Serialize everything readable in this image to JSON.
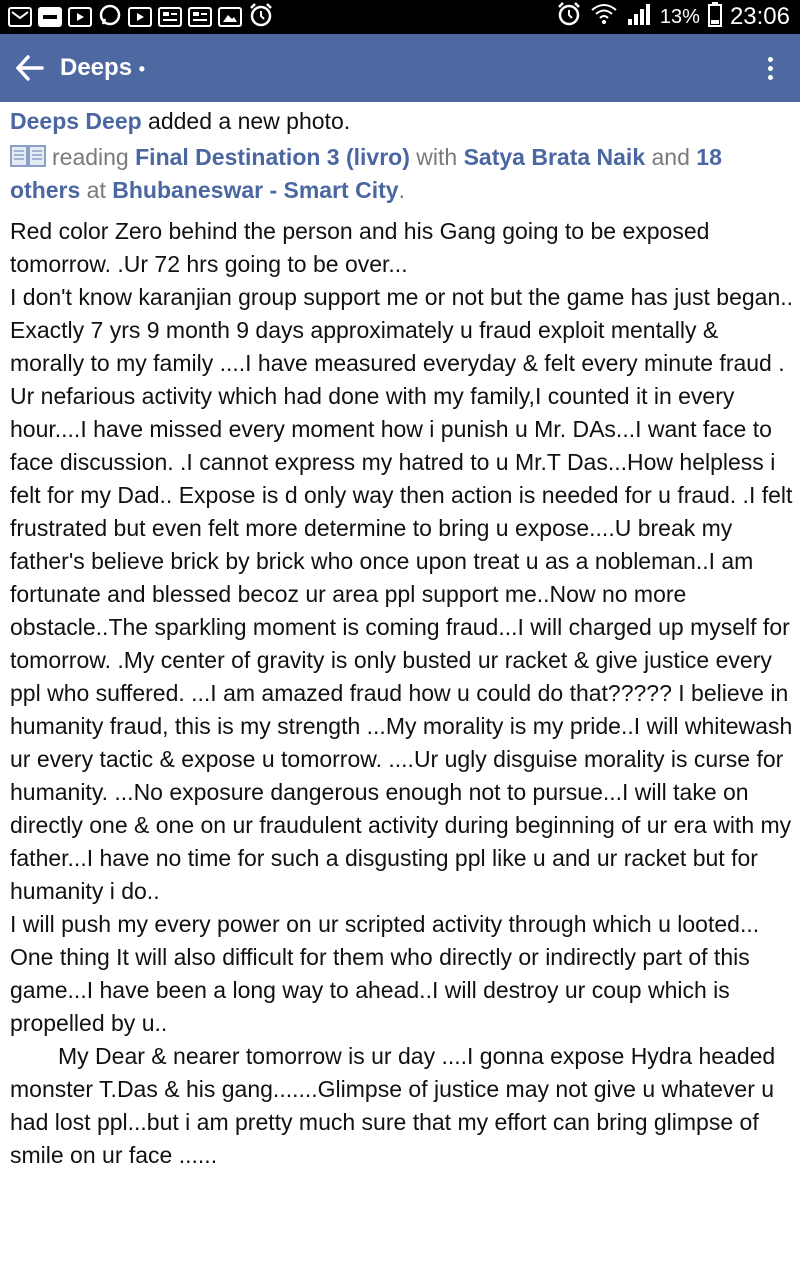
{
  "status_bar": {
    "battery_percent": "13%",
    "time": "23:06"
  },
  "app_bar": {
    "title": "Deeps",
    "title_dot": "•"
  },
  "post": {
    "author": "Deeps Deep",
    "action": " added a new photo.",
    "activity_verb": "reading ",
    "book": "Final Destination 3 (livro)",
    "with_word": " with ",
    "tagged_person": "Satya Brata Naik",
    "and_word": " and ",
    "others": "18 others",
    "at_word": " at ",
    "location": "Bhubaneswar - Smart City",
    "end_period": ".",
    "paragraphs": [
      "Red color Zero behind the person and his Gang going to be exposed tomorrow. .Ur 72 hrs going to be over...",
      "I don't know karanjian group  support me or not but the game has just began..",
      "Exactly 7 yrs 9 month 9 days approximately u fraud exploit mentally & morally to my family ....I have measured everyday & felt every minute fraud . Ur nefarious activity which had done with my family,I counted it in every hour....I have missed every moment how i punish u Mr. DAs...I want  face to face discussion. .I cannot express my hatred to u Mr.T Das...How helpless i felt for my Dad.. Expose is d only way then action is needed for u fraud. .I felt frustrated but even felt more determine to bring u expose....U break my father's believe  brick by brick who once upon treat u as a nobleman..I am fortunate and blessed becoz ur area ppl support me..Now no more obstacle..The sparkling moment is coming fraud...I will charged up myself for tomorrow. .My center of gravity is only busted ur racket & give justice every ppl who suffered. ...I am amazed fraud how u could do that????? I believe in humanity fraud, this is my strength ...My morality is my pride..I will whitewash ur every tactic & expose u tomorrow. ....Ur ugly disguise morality is curse for humanity. ...No exposure dangerous enough not to pursue...I will take on directly one & one on ur fraudulent activity during beginning of ur era with my father...I have no time for such a disgusting ppl like u and ur racket but for humanity i do..",
      "I will push my every power on ur scripted activity through which u looted...",
      "One thing It will also difficult for them who directly or indirectly part of this game...I have been a long way to ahead..I will destroy ur coup which is propelled by u..",
      "My Dear & nearer tomorrow is ur day ....I gonna expose Hydra headed monster T.Das & his gang.......Glimpse of justice may not give u whatever u had lost ppl...but i am pretty much sure that my effort can bring  glimpse of smile on ur face ......"
    ]
  },
  "icons": [
    "mail-icon",
    "paytm-icon",
    "youtube-icon",
    "whatsapp-icon",
    "youtube-icon",
    "news-icon",
    "news-icon",
    "gallery-icon",
    "alarm-icon",
    "wifi-icon",
    "signal-icon",
    "battery-icon",
    "back-arrow-icon",
    "overflow-menu-icon",
    "book-icon"
  ],
  "colors": {
    "app_bar": "#4e69a2",
    "link_blue": "#4b67a1",
    "status_bar": "#000000"
  }
}
